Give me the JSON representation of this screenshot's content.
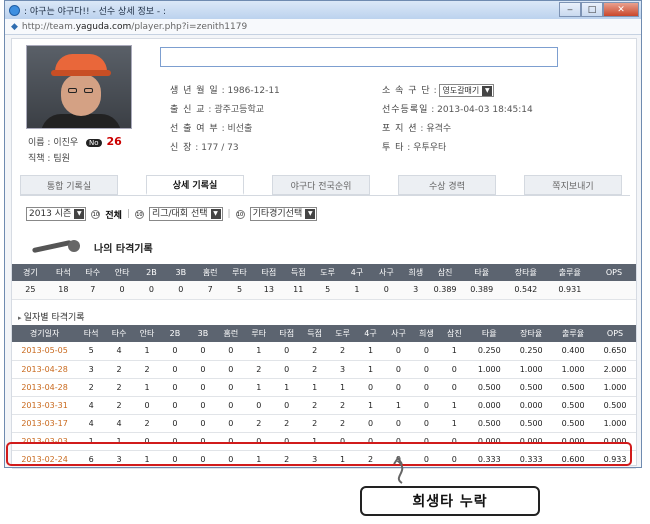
{
  "window": {
    "title": ": 야구는 야구다!! - 선수 상세 정보 - :",
    "url_prefix": "http://team.",
    "url_host": "yaguda.com",
    "url_path": "/player.php?i=zenith1179",
    "buttons": {
      "minimize": "‒",
      "maximize": "□",
      "close": "✕"
    }
  },
  "profile": {
    "name": "이름 : 이진우",
    "no_badge": "No",
    "number": "26",
    "position": "직책 : 팀원",
    "search_value": "",
    "fields_left": [
      {
        "key": "생 년 월 일",
        "value": "1986-12-11"
      },
      {
        "key": "출 신 교",
        "value": "광주고등학교"
      },
      {
        "key": "선 출 여 부",
        "value": "비선출"
      },
      {
        "key": "신 장",
        "value": "177 / 73"
      }
    ],
    "fields_right": [
      {
        "key": "소 속 구 단",
        "value": "영도갈매기"
      },
      {
        "key": "선수등록일",
        "value": "2013-04-03 18:45:14"
      },
      {
        "key": "포 지 션",
        "value": "유격수"
      },
      {
        "key": "투 타",
        "value": "우투우타"
      }
    ]
  },
  "tabs": [
    {
      "label": "통합 기록실"
    },
    {
      "label": "상세 기록실"
    },
    {
      "label": "야구다 전국순위"
    },
    {
      "label": "수상 경력"
    },
    {
      "label": "쪽지보내기"
    }
  ],
  "filters": {
    "season": "2013 시즌",
    "all": "전체",
    "league": "리그/대회 선택",
    "other": "기타경기선택",
    "sep": "|"
  },
  "my_batting_title": "나의 타격기록",
  "totals": {
    "headers": [
      "경기",
      "타석",
      "타수",
      "안타",
      "2B",
      "3B",
      "홈런",
      "루타",
      "타점",
      "득점",
      "도루",
      "4구",
      "사구",
      "희생",
      "삼진",
      "타율",
      "장타율",
      "출루율",
      "OPS"
    ],
    "row": [
      "25",
      "18",
      "7",
      "0",
      "0",
      "0",
      "7",
      "5",
      "13",
      "11",
      "5",
      "1",
      "0",
      "3",
      "0.389",
      "0.389",
      "0.542",
      "0.931"
    ]
  },
  "daily_title": "일자별 타격기록",
  "daily": {
    "headers": [
      "경기일자",
      "타석",
      "타수",
      "안타",
      "2B",
      "3B",
      "홈런",
      "루타",
      "타점",
      "득점",
      "도루",
      "4구",
      "사구",
      "희생",
      "삼진",
      "타율",
      "장타율",
      "출루율",
      "OPS"
    ],
    "rows": [
      [
        "2013-05-05",
        "5",
        "4",
        "1",
        "0",
        "0",
        "0",
        "1",
        "0",
        "2",
        "2",
        "1",
        "0",
        "0",
        "1",
        "0.250",
        "0.250",
        "0.400",
        "0.650"
      ],
      [
        "2013-04-28",
        "3",
        "2",
        "2",
        "0",
        "0",
        "0",
        "2",
        "0",
        "2",
        "3",
        "1",
        "0",
        "0",
        "0",
        "1.000",
        "1.000",
        "1.000",
        "2.000"
      ],
      [
        "2013-04-28",
        "2",
        "2",
        "1",
        "0",
        "0",
        "0",
        "1",
        "1",
        "1",
        "1",
        "0",
        "0",
        "0",
        "0",
        "0.500",
        "0.500",
        "0.500",
        "1.000"
      ],
      [
        "2013-03-31",
        "4",
        "2",
        "0",
        "0",
        "0",
        "0",
        "0",
        "0",
        "2",
        "2",
        "1",
        "1",
        "0",
        "1",
        "0.000",
        "0.000",
        "0.500",
        "0.500"
      ],
      [
        "2013-03-17",
        "4",
        "4",
        "2",
        "0",
        "0",
        "0",
        "2",
        "2",
        "2",
        "2",
        "0",
        "0",
        "0",
        "1",
        "0.500",
        "0.500",
        "0.500",
        "1.000"
      ],
      [
        "2013-03-03",
        "1",
        "1",
        "0",
        "0",
        "0",
        "0",
        "0",
        "0",
        "1",
        "0",
        "0",
        "0",
        "0",
        "0",
        "0.000",
        "0.000",
        "0.000",
        "0.000"
      ],
      [
        "2013-02-24",
        "6",
        "3",
        "1",
        "0",
        "0",
        "0",
        "1",
        "2",
        "3",
        "1",
        "2",
        "0",
        "0",
        "0",
        "0.333",
        "0.333",
        "0.600",
        "0.933"
      ]
    ]
  },
  "annotation": {
    "note": "희생타 누락",
    "color": "#d11b1b"
  }
}
